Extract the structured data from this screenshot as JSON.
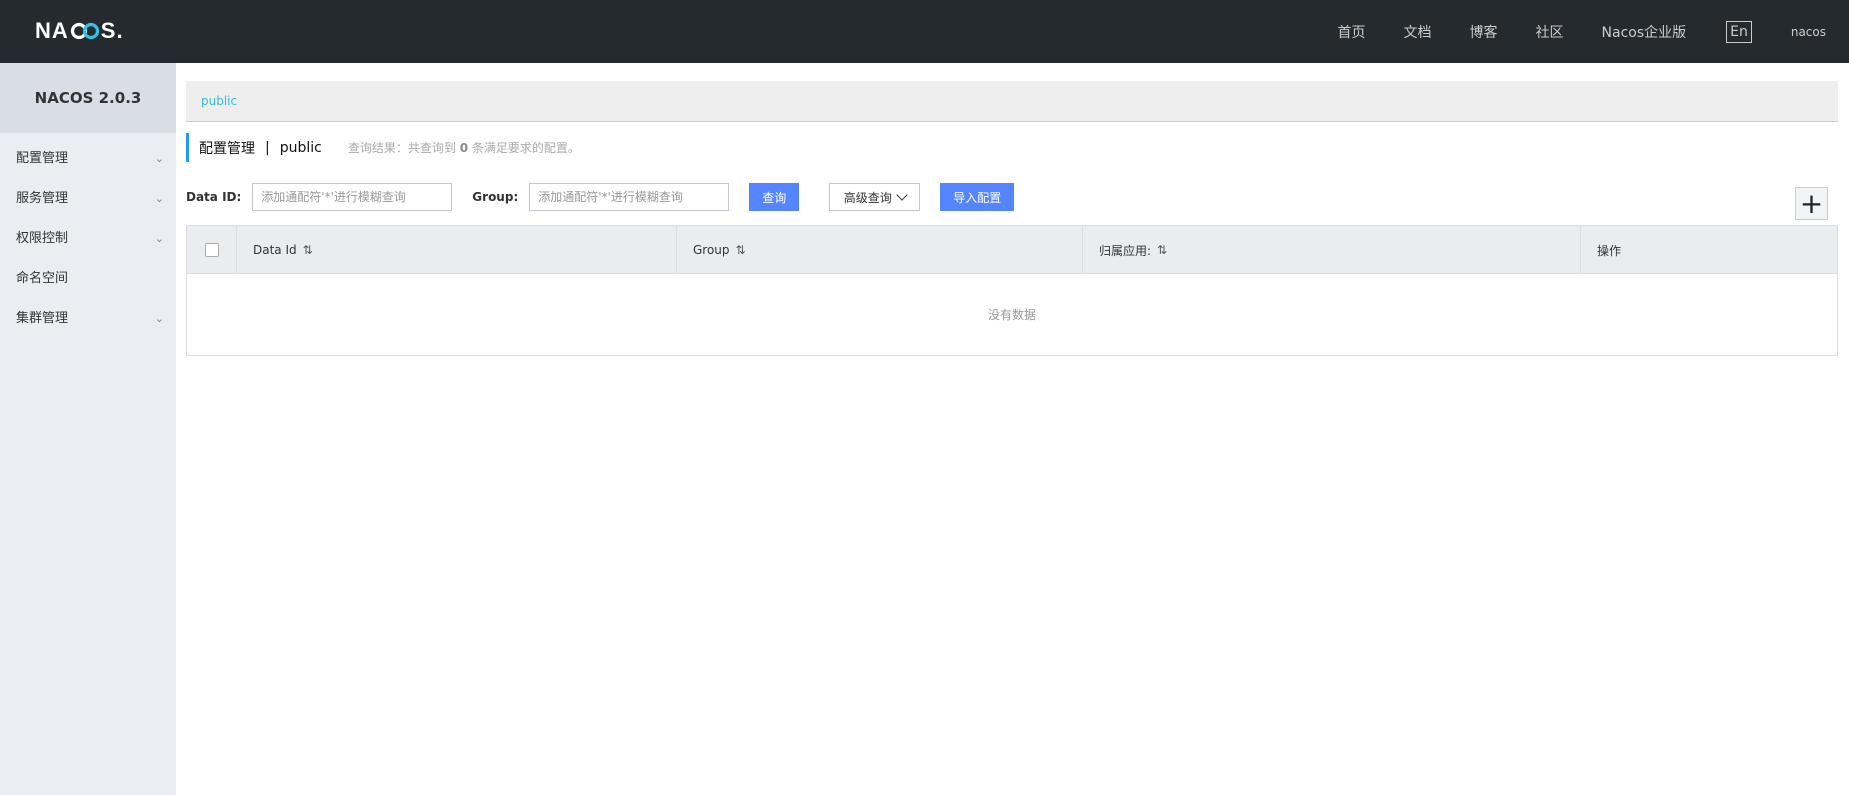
{
  "header": {
    "logo_text_left": "NA",
    "logo_text_right": "S.",
    "nav": [
      "首页",
      "文档",
      "博客",
      "社区",
      "Nacos企业版"
    ],
    "lang_button": "En",
    "user": "nacos"
  },
  "sidebar": {
    "title": "NACOS 2.0.3",
    "items": [
      {
        "label": "配置管理",
        "expandable": true
      },
      {
        "label": "服务管理",
        "expandable": true
      },
      {
        "label": "权限控制",
        "expandable": true
      },
      {
        "label": "命名空间",
        "expandable": false
      },
      {
        "label": "集群管理",
        "expandable": true
      }
    ]
  },
  "namespace_bar": {
    "current": "public"
  },
  "page": {
    "title": "配置管理",
    "separator": "|",
    "namespace": "public",
    "result_prefix": "查询结果：共查询到",
    "result_count": "0",
    "result_suffix": "条满足要求的配置。"
  },
  "filter": {
    "data_id_label": "Data ID:",
    "data_id_placeholder": "添加通配符'*'进行模糊查询",
    "data_id_value": "",
    "group_label": "Group:",
    "group_placeholder": "添加通配符'*'进行模糊查询",
    "group_value": "",
    "search_button": "查询",
    "advanced_button": "高级查询",
    "import_button": "导入配置"
  },
  "add_button": "+",
  "table": {
    "columns": [
      "Data Id",
      "Group",
      "归属应用:",
      "操作"
    ],
    "empty_text": "没有数据"
  }
}
